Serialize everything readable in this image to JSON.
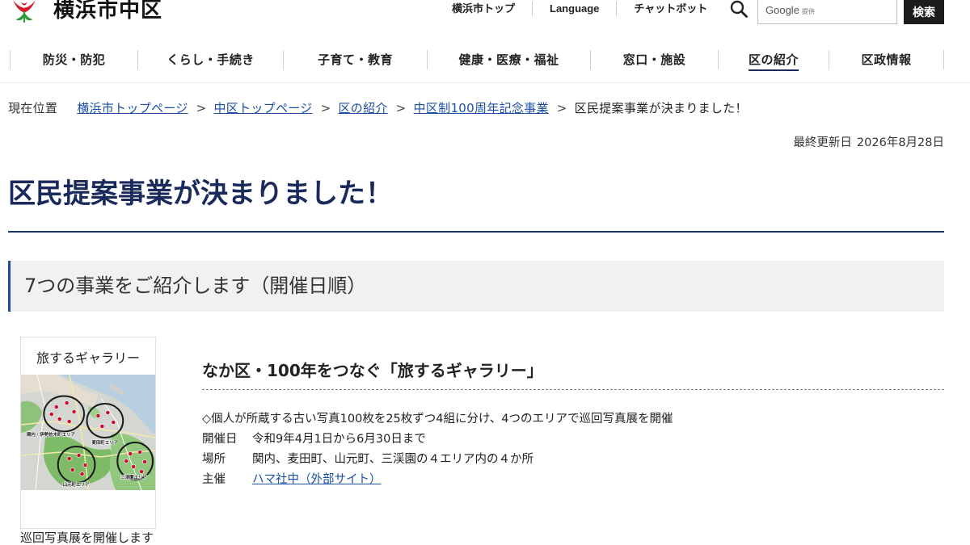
{
  "header": {
    "logo_icon": "yokohama-city-mark",
    "site_title": "横浜市中区",
    "utility_links": [
      {
        "label": "横浜市トップ"
      },
      {
        "label": "Language"
      },
      {
        "label": "チャットボット"
      }
    ],
    "search": {
      "icon": "search-icon",
      "placeholder_brand": "Google",
      "placeholder_suffix": "提供",
      "button_label": "検索"
    }
  },
  "global_nav": {
    "items": [
      {
        "label": "防災・防犯",
        "active": false
      },
      {
        "label": "くらし・手続き",
        "active": false
      },
      {
        "label": "子育て・教育",
        "active": false
      },
      {
        "label": "健康・医療・福祉",
        "active": false
      },
      {
        "label": "窓口・施設",
        "active": false
      },
      {
        "label": "区の紹介",
        "active": true
      },
      {
        "label": "区政情報",
        "active": false
      }
    ]
  },
  "breadcrumb": {
    "label": "現在位置",
    "separator": ">",
    "links": [
      "横浜市トップページ",
      "中区トップページ",
      "区の紹介",
      "中区制100周年記念事業"
    ],
    "current": "区民提案事業が決まりました！"
  },
  "last_updated": {
    "label": "最終更新日",
    "date": "2026年8月28日"
  },
  "page_title": "区民提案事業が決まりました！",
  "section_heading": "7つの事業をご紹介します（開催日順）",
  "events": [
    {
      "image": {
        "title": "旅するギャラリー",
        "map_labels": [
          "関内・伊勢佐木町エリア",
          "麦田町エリア",
          "山元町エリア",
          "三渓園エリア"
        ],
        "caption": "巡回写真展を開催します"
      },
      "title": "なか区・100年をつなぐ「旅するギャラリー」",
      "description": "◇個人が所蔵する古い写真100枚を25枚ずつ4組に分け、4つのエリアで巡回写真展を開催",
      "details": [
        {
          "label": "開催日",
          "value": "令和9年4月1日から6月30日まで"
        },
        {
          "label": "場所",
          "value": "関内、麦田町、山元町、三渓園の４エリア内の４か所"
        },
        {
          "label": "主催",
          "value": "ハマ社中（外部サイト）",
          "is_link": true
        }
      ]
    }
  ],
  "colors": {
    "brand_navy": "#1b2a5c",
    "link_blue": "#1a4fa5",
    "section_accent": "#1e4ca0",
    "search_button": "#1c1c1c"
  }
}
